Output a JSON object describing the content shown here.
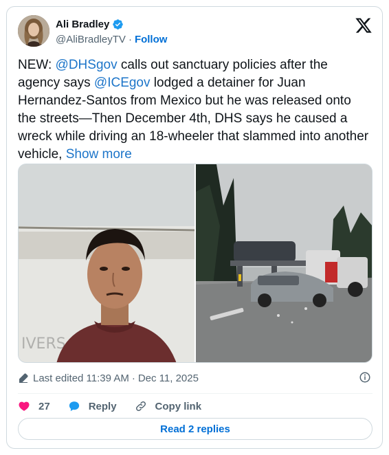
{
  "author": {
    "display_name": "Ali Bradley",
    "handle": "@AliBradleyTV",
    "separator": "·",
    "follow_label": "Follow",
    "verified_color": "#1d9bf0"
  },
  "tweet": {
    "segments": [
      {
        "text": "NEW: ",
        "type": "text"
      },
      {
        "text": "@DHSgov",
        "type": "mention"
      },
      {
        "text": " calls out sanctuary policies after the agency says ",
        "type": "text"
      },
      {
        "text": "@ICEgov",
        "type": "mention"
      },
      {
        "text": " lodged a detainer for Juan Hernandez-Santos from Mexico but he was released onto the streets—Then December 4th, DHS says he caused a wreck while driving an 18-wheeler that slammed into another vehicle, ",
        "type": "text"
      }
    ],
    "show_more": "Show more"
  },
  "media": {
    "image_left_desc": "portrait-photo",
    "image_right_desc": "crash-scene-photo"
  },
  "meta": {
    "edited_label": "Last edited 11:39 AM",
    "separator": "·",
    "date": "Dec 11, 2025"
  },
  "actions": {
    "like_count": "27",
    "reply_label": "Reply",
    "copy_link_label": "Copy link"
  },
  "read_replies_label": "Read 2 replies",
  "colors": {
    "accent": "#1d9bf0",
    "link": "#006fd6",
    "like": "#f91880",
    "muted": "#536471",
    "border": "#cfd9de"
  }
}
